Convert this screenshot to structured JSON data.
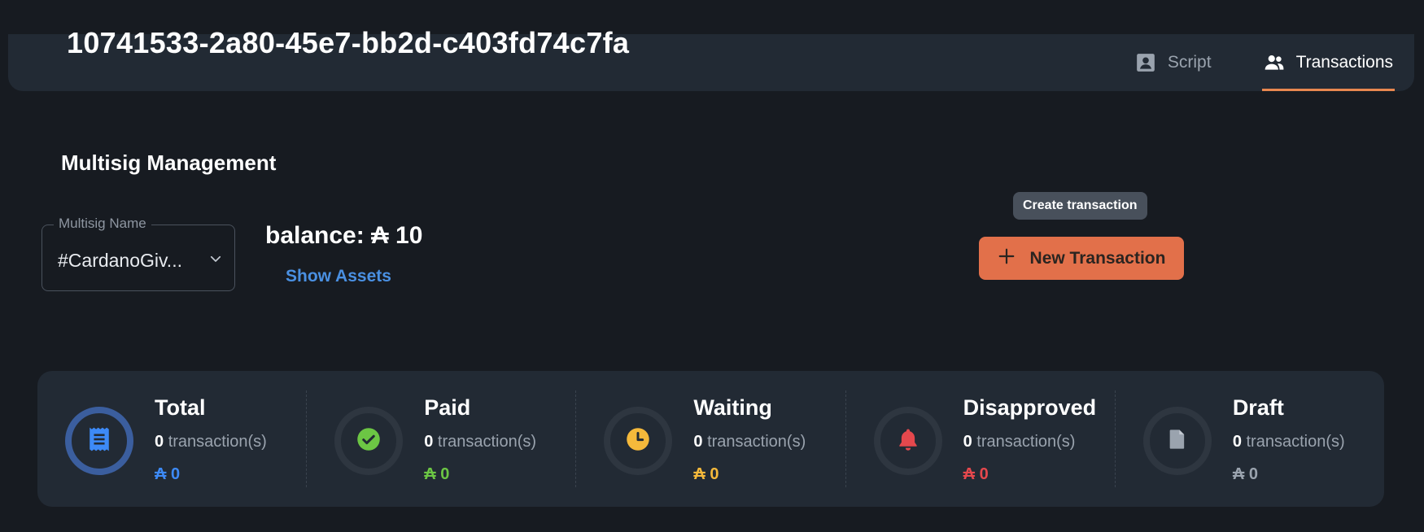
{
  "header": {
    "title": "10741533-2a80-45e7-bb2d-c403fd74c7fa",
    "tabs": [
      {
        "label": "Script",
        "icon": "portrait-icon",
        "active": false
      },
      {
        "label": "Transactions",
        "icon": "users-icon",
        "active": true
      }
    ],
    "accent_color": "#e8874f"
  },
  "main": {
    "section_title": "Multisig Management",
    "multisig_select": {
      "label": "Multisig Name",
      "value": "#CardanoGiv..."
    },
    "balance": "balance: ₳ 10",
    "show_assets": "Show Assets",
    "tooltip": "Create transaction",
    "new_transaction_button": {
      "label": "New Transaction",
      "color": "#e2704a"
    }
  },
  "stats": [
    {
      "title": "Total",
      "count": "0",
      "unit": "transaction(s)",
      "amount": "₳ 0",
      "color": "#3d8af7",
      "icon": "receipt-icon"
    },
    {
      "title": "Paid",
      "count": "0",
      "unit": "transaction(s)",
      "amount": "₳ 0",
      "color": "#6cc644",
      "icon": "check-circle-icon"
    },
    {
      "title": "Waiting",
      "count": "0",
      "unit": "transaction(s)",
      "amount": "₳ 0",
      "color": "#f5b93b",
      "icon": "clock-icon"
    },
    {
      "title": "Disapproved",
      "count": "0",
      "unit": "transaction(s)",
      "amount": "₳ 0",
      "color": "#e5484d",
      "icon": "bell-icon"
    },
    {
      "title": "Draft",
      "count": "0",
      "unit": "transaction(s)",
      "amount": "₳ 0",
      "color": "#9aa3ae",
      "icon": "document-icon"
    }
  ]
}
